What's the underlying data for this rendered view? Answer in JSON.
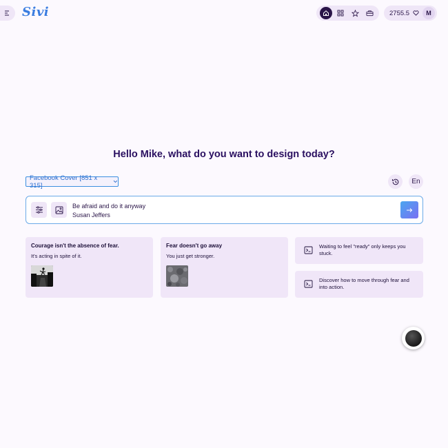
{
  "app": {
    "logo": "Sivi",
    "accent": "#3a7de0",
    "nav_icons": [
      "home-icon",
      "grid-icon",
      "star-icon",
      "briefcase-icon"
    ],
    "credits": "2755.5",
    "credits_icon": "heart-icon",
    "avatar_initial": "M"
  },
  "hero": {
    "greeting": "Hello Mike, what do you want to design today?"
  },
  "toolbar": {
    "size_label": "Facebook Cover [851 x 315]",
    "language": "En",
    "history_icon": "history-icon"
  },
  "prompt": {
    "line1": "Be afraid and do it anyway",
    "line2": "Susan Jeffers",
    "settings_icon": "sliders-icon",
    "image_icon": "image-icon",
    "send_icon": "arrow-right-icon"
  },
  "cards": [
    {
      "title": "Courage isn't the absence of fear.",
      "subtitle": "It's acting in spite of it."
    },
    {
      "title": "Fear doesn't go away",
      "subtitle": "You just get stronger."
    }
  ],
  "ideas": [
    {
      "text": "Waiting to feel \"ready\" only keeps you stuck."
    },
    {
      "text": "Discover how to move through fear and into action."
    }
  ]
}
